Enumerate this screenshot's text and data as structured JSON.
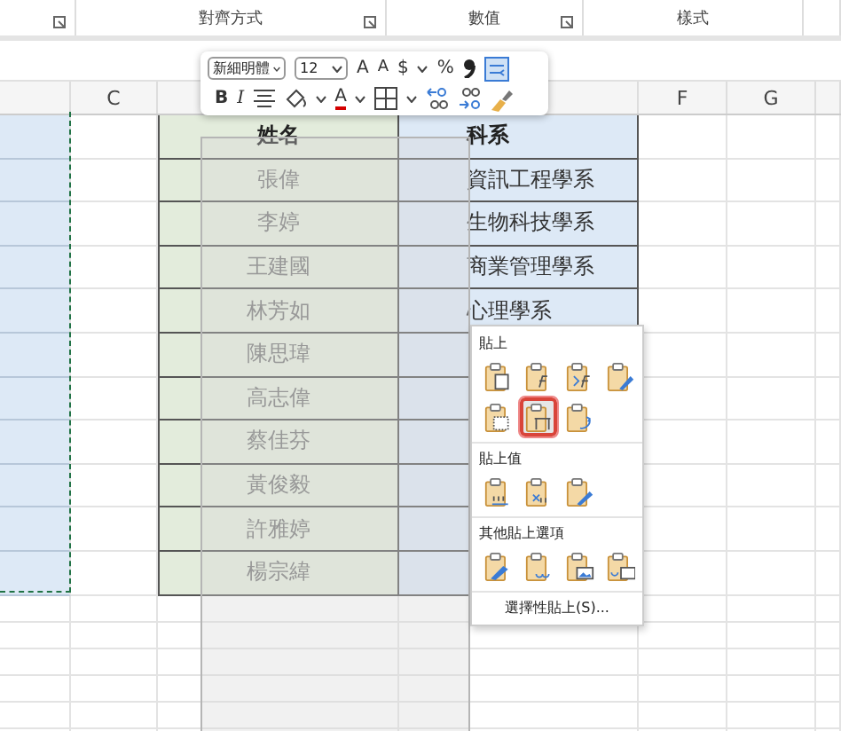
{
  "ribbon": {
    "groups": [
      {
        "label": "對齊方式"
      },
      {
        "label": "數值"
      },
      {
        "label": "樣式"
      }
    ]
  },
  "mini_toolbar": {
    "font": "新細明體",
    "size": "12",
    "rows": [
      [
        {
          "kind": "grow",
          "label": "A"
        },
        {
          "kind": "shrink",
          "label": "A"
        },
        {
          "kind": "currency",
          "label": "$"
        },
        {
          "kind": "caret"
        },
        {
          "kind": "percent",
          "label": "%"
        },
        {
          "kind": "comma"
        },
        {
          "kind": "wrap"
        }
      ],
      [
        {
          "kind": "bold",
          "label": "B"
        },
        {
          "kind": "italic",
          "label": "I"
        },
        {
          "kind": "align"
        },
        {
          "kind": "fill"
        },
        {
          "kind": "caret"
        },
        {
          "kind": "font-color",
          "label": "A"
        },
        {
          "kind": "caret"
        },
        {
          "kind": "borders"
        },
        {
          "kind": "caret"
        },
        {
          "kind": "inc-decimal"
        },
        {
          "kind": "dec-decimal"
        },
        {
          "kind": "painter"
        }
      ]
    ]
  },
  "sheet": {
    "columns": [
      {
        "kind": "blank"
      },
      {
        "kind": "label",
        "label": "C"
      },
      {
        "kind": "blank"
      },
      {
        "kind": "blank"
      },
      {
        "kind": "label",
        "label": "F"
      },
      {
        "kind": "label",
        "label": "G"
      },
      {
        "kind": "blank"
      }
    ],
    "rows": [
      {
        "kind": "header",
        "name": "姓名",
        "dept": "科系"
      },
      {
        "kind": "data",
        "name": "張偉",
        "dept": "資訊工程學系"
      },
      {
        "kind": "data",
        "name": "李婷",
        "dept": "生物科技學系"
      },
      {
        "kind": "data",
        "name": "王建國",
        "dept": "商業管理學系"
      },
      {
        "kind": "data",
        "name": "林芳如",
        "dept": "心理學系"
      },
      {
        "kind": "data",
        "name": "陳思瑋"
      },
      {
        "kind": "data",
        "name": "高志偉"
      },
      {
        "kind": "data",
        "name": "蔡佳芬"
      },
      {
        "kind": "data",
        "name": "黃俊毅"
      },
      {
        "kind": "data",
        "name": "許雅婷"
      },
      {
        "kind": "data",
        "name": "楊宗緯"
      }
    ]
  },
  "context_menu": {
    "sections": [
      {
        "title": "貼上",
        "options": [
          {
            "kind": "paste",
            "selected": false
          },
          {
            "kind": "formulas",
            "selected": false
          },
          {
            "kind": "formulas-format",
            "selected": false
          },
          {
            "kind": "keep-source",
            "selected": false
          },
          {
            "kind": "no-borders",
            "selected": false
          },
          {
            "kind": "keep-widths",
            "selected": true
          },
          {
            "kind": "transpose",
            "selected": false
          }
        ]
      },
      {
        "title": "貼上值",
        "options": [
          {
            "kind": "values",
            "selected": false
          },
          {
            "kind": "values-number",
            "selected": false
          },
          {
            "kind": "values-source",
            "selected": false
          }
        ]
      },
      {
        "title": "其他貼上選項",
        "options": [
          {
            "kind": "formatting",
            "selected": false
          },
          {
            "kind": "link",
            "selected": false
          },
          {
            "kind": "picture",
            "selected": false
          },
          {
            "kind": "linked-picture",
            "selected": false
          }
        ]
      }
    ],
    "footer": "選擇性貼上(S)..."
  }
}
